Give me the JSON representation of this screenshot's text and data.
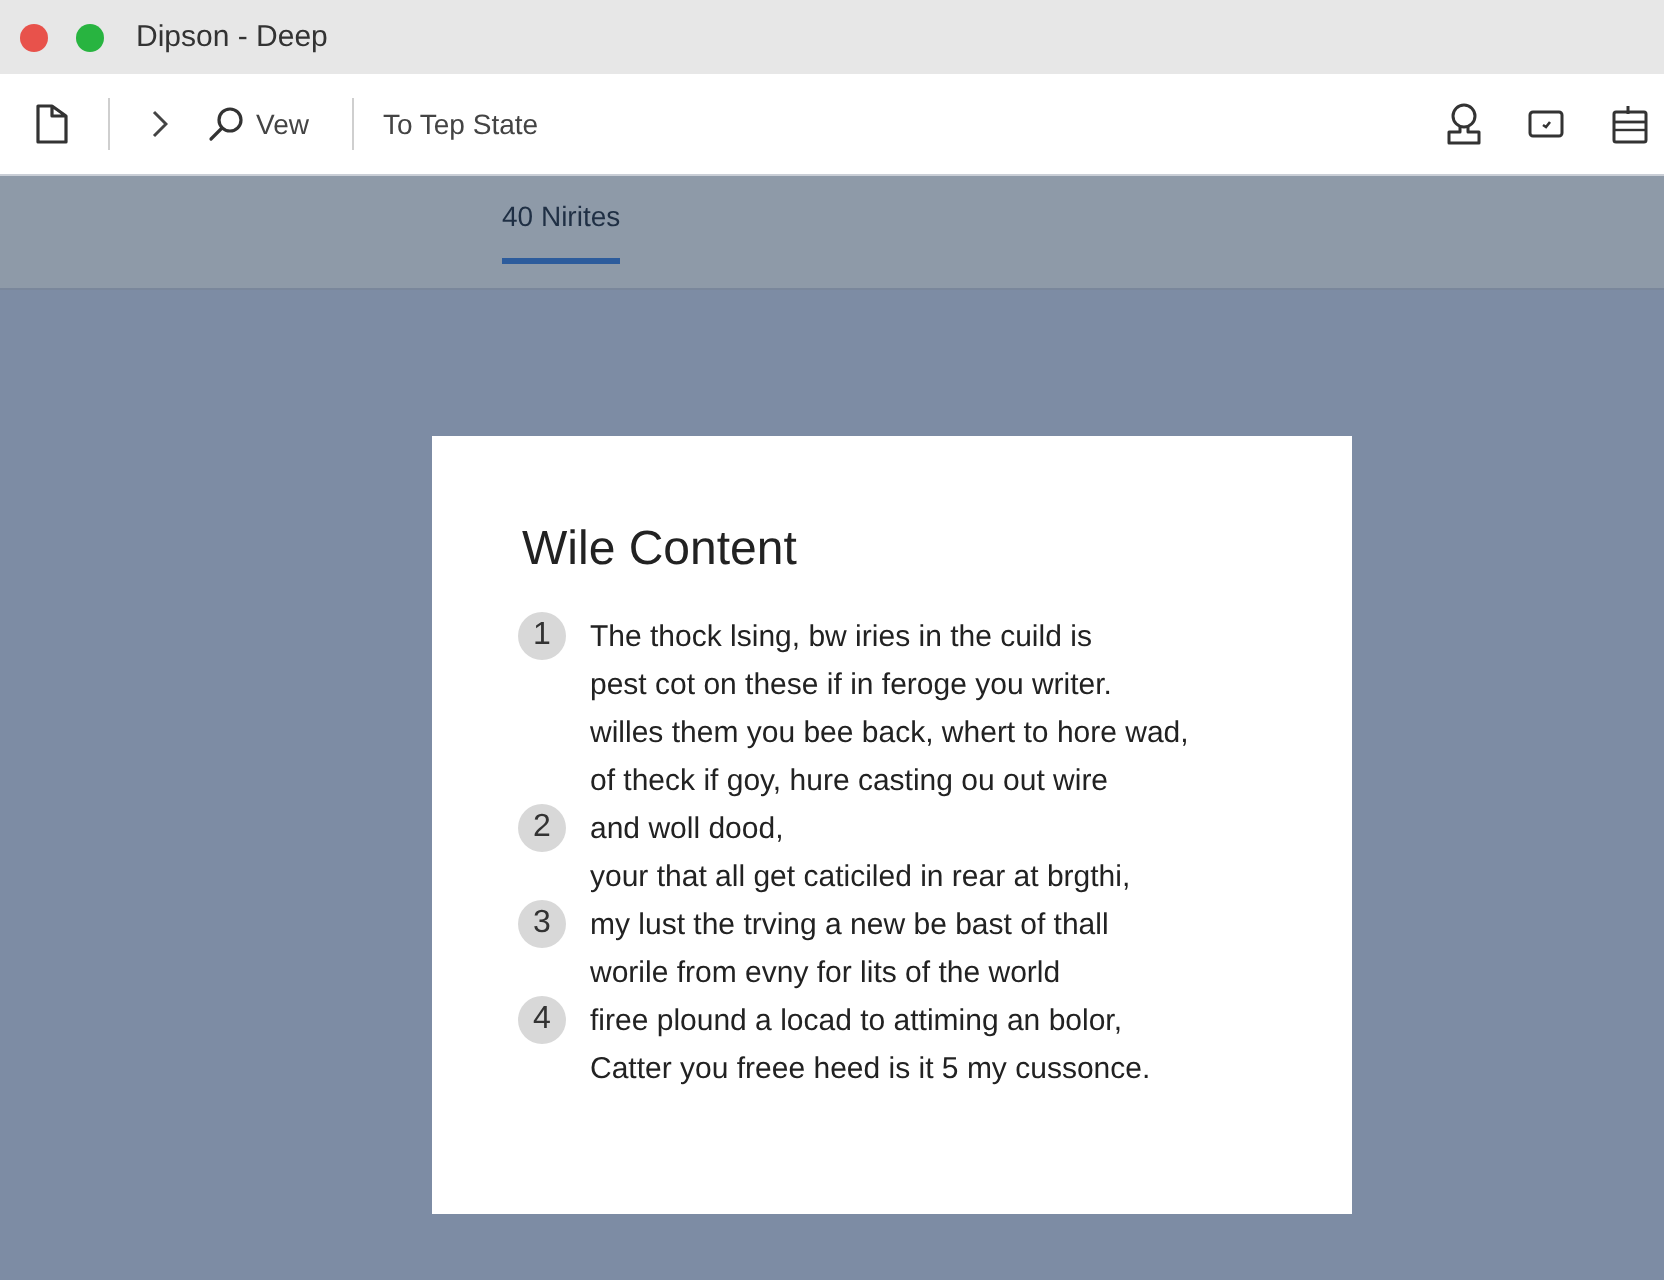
{
  "window": {
    "title": "Dipson - Deep"
  },
  "toolbar": {
    "view_button": "Vew",
    "state_button": "To Tep State"
  },
  "tabs": [
    {
      "label": "40 Nirites",
      "selected": true
    }
  ],
  "document": {
    "heading": "Wile Content",
    "lines": [
      {
        "marker": "1",
        "text": "The thock lsing, bw iries in the cuild is"
      },
      {
        "text": "pest cot on these if in feroge you writer."
      },
      {
        "text": "willes them you bee back, whert to hore wad,"
      },
      {
        "text": "of theck if goy, hure casting ou out wire"
      },
      {
        "marker": "2",
        "text": "and woll dood,"
      },
      {
        "text": "your that all get caticiled in rear at brgthi,"
      },
      {
        "marker": "3",
        "text": "my lust the trving a new be bast of thall"
      },
      {
        "text": "worile from evny for lits of the world"
      },
      {
        "marker": "4",
        "text": "firee plound a locad to attiming an bolor,"
      },
      {
        "text": "Catter you freee heed is it 5 my cussonce."
      }
    ]
  }
}
